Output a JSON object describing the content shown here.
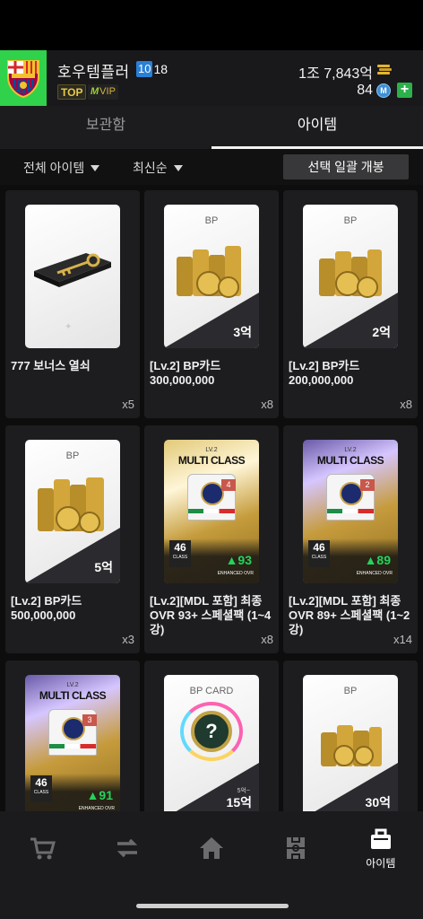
{
  "header": {
    "team_name": "호우템플러",
    "level_prefix": "10",
    "level_suffix": "18",
    "top_badge": "TOP",
    "vip_prefix": "M",
    "vip_text": "VIP",
    "bp_balance": "1조 7,843억",
    "mc_balance": "84",
    "mc_icon_text": "M",
    "add_label": "+"
  },
  "tabs": [
    {
      "label": "보관함",
      "active": false
    },
    {
      "label": "아이템",
      "active": true
    }
  ],
  "filters": {
    "category": "전체 아이템",
    "sort": "최신순",
    "open_all_label": "선택 일괄 개봉"
  },
  "items": [
    {
      "name": "777 보너스 열쇠",
      "count": "x5",
      "type": "key"
    },
    {
      "name": "[Lv.2] BP카드 300,000,000",
      "count": "x8",
      "type": "bp",
      "card_label": "BP",
      "amount": "3억"
    },
    {
      "name": "[Lv.2] BP카드 200,000,000",
      "count": "x8",
      "type": "bp",
      "card_label": "BP",
      "amount": "2억"
    },
    {
      "name": "[Lv.2] BP카드 500,000,000",
      "count": "x3",
      "type": "bp",
      "card_label": "BP",
      "amount": "5억"
    },
    {
      "name": "[Lv.2][MDL 포함] 최종 OVR 93+ 스페셜팩 (1~4강)",
      "count": "x8",
      "type": "pack",
      "lv": "LV.2",
      "title": "MULTI CLASS",
      "enh": "4",
      "class_num": "46",
      "class_label": "CLASS",
      "ovr": "▲93",
      "ovr_label": "ENHANCED OVR"
    },
    {
      "name": "[Lv.2][MDL 포함] 최종 OVR 89+ 스페셜팩 (1~2강)",
      "count": "x14",
      "type": "pack",
      "lv": "LV.2",
      "title": "MULTI CLASS",
      "enh": "2",
      "class_num": "46",
      "class_label": "CLASS",
      "ovr": "▲89",
      "ovr_label": "ENHANCED OVR"
    },
    {
      "name": "",
      "count": "",
      "type": "pack",
      "lv": "LV.2",
      "title": "MULTI CLASS",
      "enh": "3",
      "class_num": "46",
      "class_label": "CLASS",
      "ovr": "▲91",
      "ovr_label": "ENHANCED OVR"
    },
    {
      "name": "",
      "count": "",
      "type": "bpcard",
      "card_label": "BP CARD",
      "note": "5억~",
      "amount": "15억"
    },
    {
      "name": "",
      "count": "",
      "type": "bp",
      "card_label": "BP",
      "amount": "30억"
    }
  ],
  "bottom_nav": [
    {
      "icon": "cart-icon",
      "label": ""
    },
    {
      "icon": "transfer-icon",
      "label": ""
    },
    {
      "icon": "home-icon",
      "label": ""
    },
    {
      "icon": "pitch-icon",
      "label": ""
    },
    {
      "icon": "item-bag-icon",
      "label": "아이템"
    }
  ],
  "colors": {
    "crest_bg": "#2fd24a",
    "level_blue": "#2a7fd6",
    "ovr_green": "#25d35b",
    "add_green": "#2cb04a"
  }
}
